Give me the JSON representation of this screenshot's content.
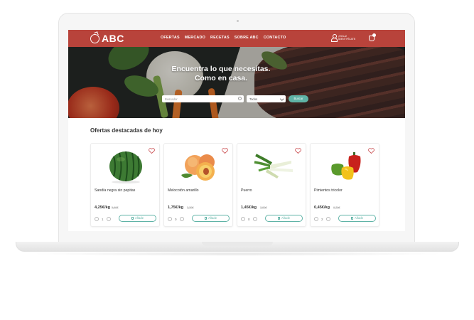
{
  "brand": {
    "name": "ABC",
    "color": "#b8433b",
    "accent": "#5fb3a6"
  },
  "nav": {
    "items": [
      "OFERTAS",
      "MERCADO",
      "RECETAS",
      "SOBRE ABC",
      "CONTACTO"
    ],
    "user_text": "¡HOLA! IDENTIFÍCATE"
  },
  "hero": {
    "title_line1": "Encuentra lo que necesitas.",
    "title_line2": "Como en casa.",
    "search_placeholder": "Buscador",
    "select_value": "Todos",
    "search_button": "Buscar"
  },
  "offers": {
    "title": "Ofertas destacadas de hoy",
    "products": [
      {
        "name": "Sandía negra sin pepitas",
        "price": "4,25€/kg",
        "old_price": "5,60€",
        "qty": "1",
        "add_label": "Añade",
        "image": "watermelon-image"
      },
      {
        "name": "Melocotón amarillo",
        "price": "1,75€/kg",
        "old_price": "2,30€",
        "qty": "0",
        "add_label": "Añade",
        "image": "peach-image"
      },
      {
        "name": "Puerro",
        "price": "1,45€/kg",
        "old_price": "2,00€",
        "qty": "0",
        "add_label": "Añade",
        "image": "leek-image"
      },
      {
        "name": "Pimientos tricolor",
        "price": "0,45€/kg",
        "old_price": "0,70€",
        "qty": "2",
        "add_label": "Añade",
        "image": "peppers-image"
      }
    ]
  }
}
